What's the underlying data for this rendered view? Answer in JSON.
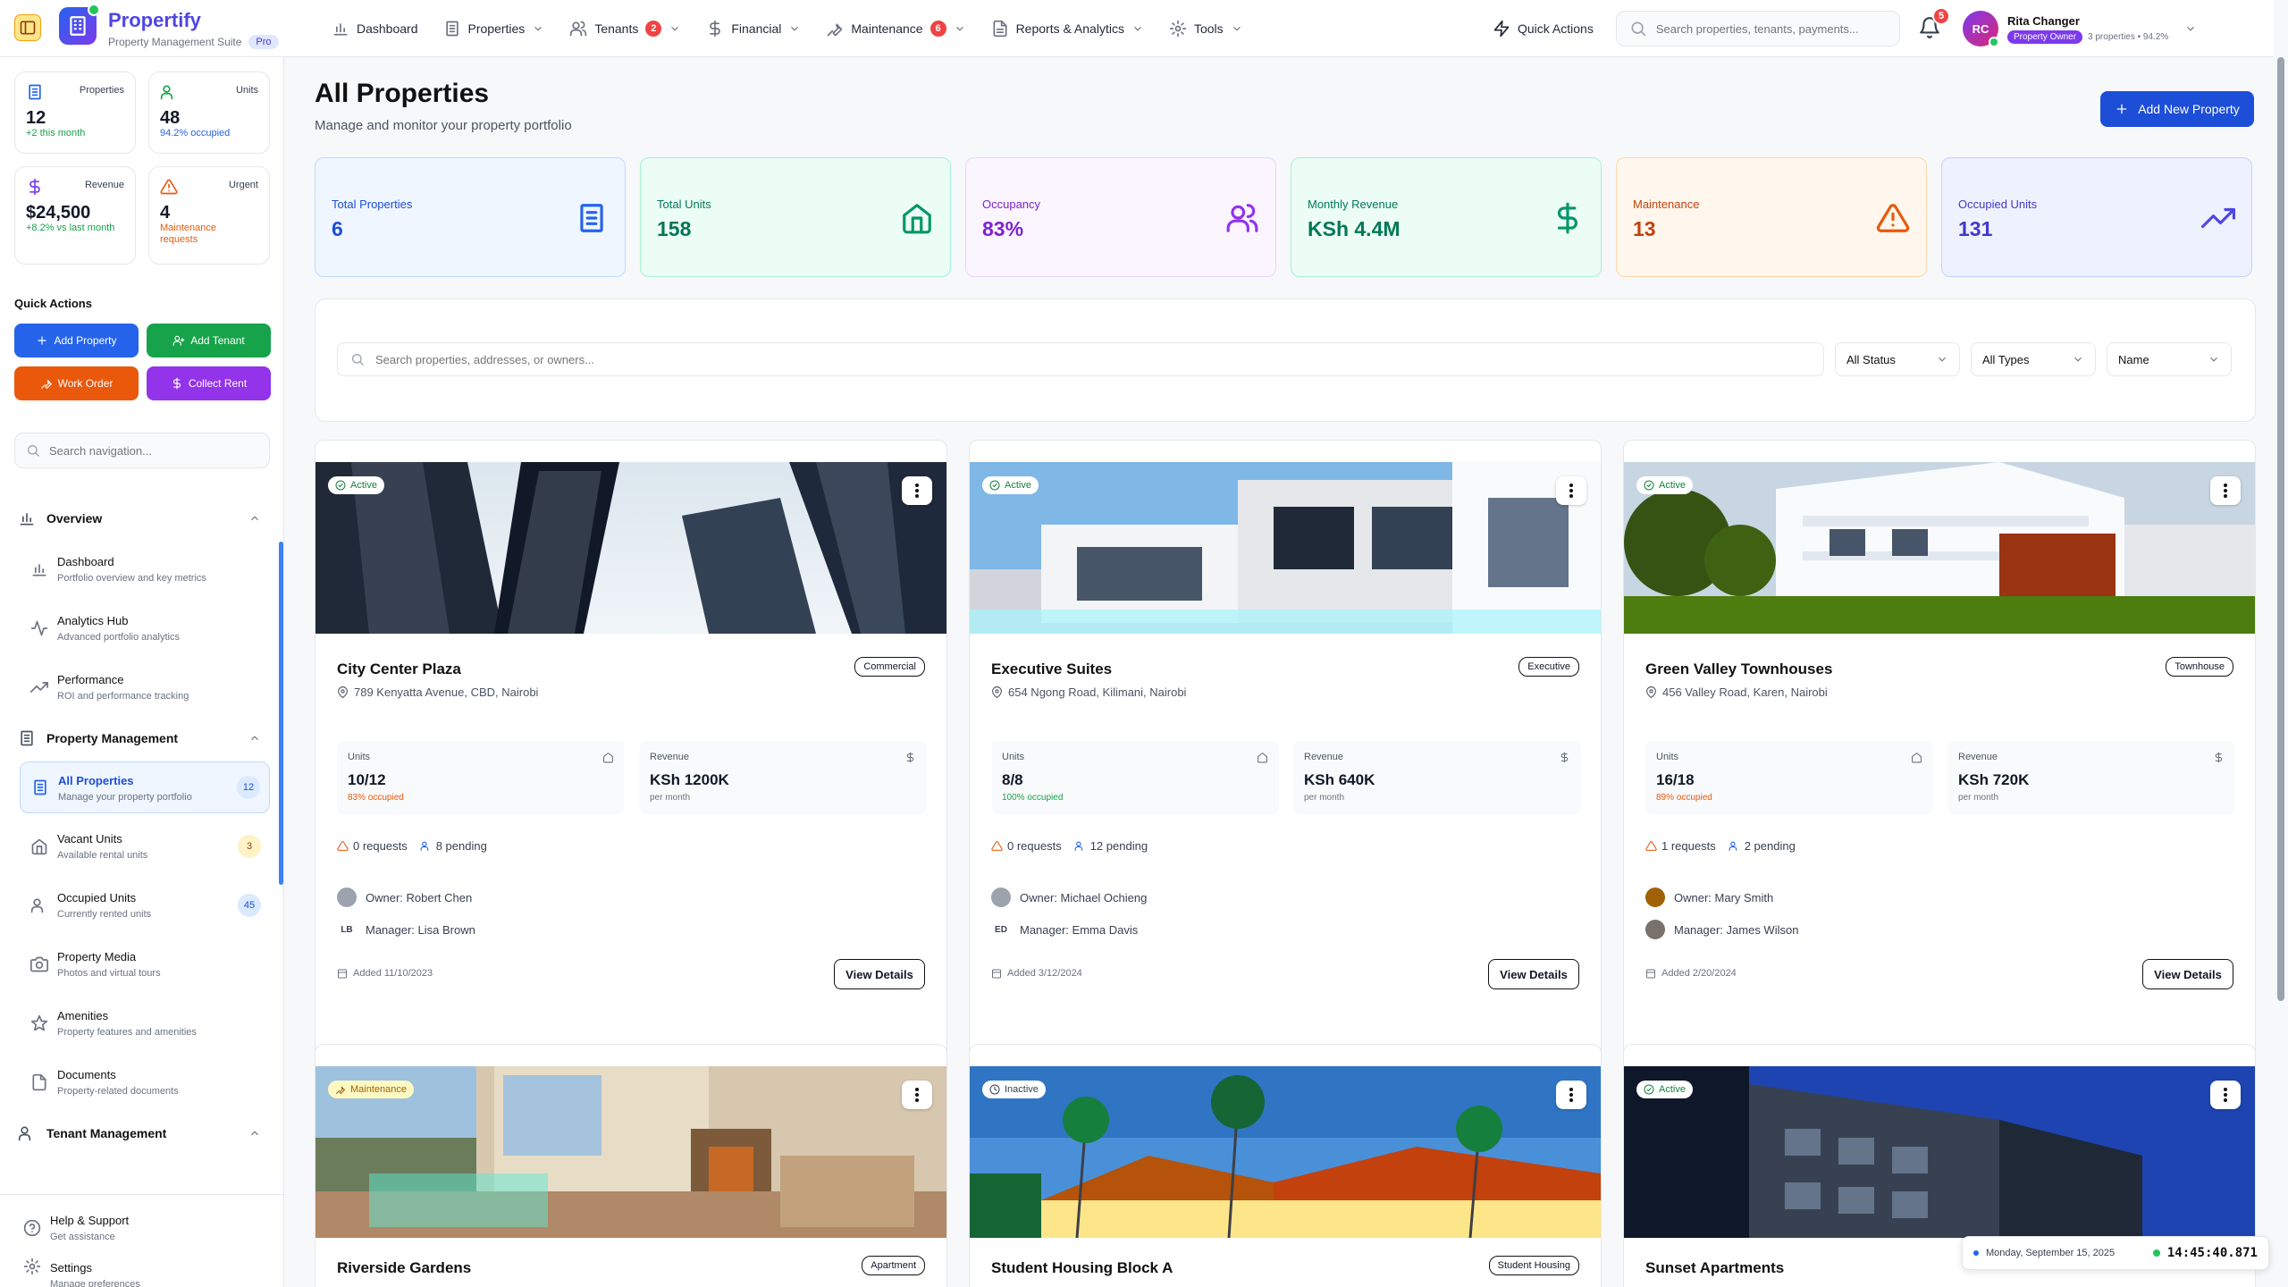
{
  "app": {
    "name": "Propertify",
    "subtitle": "Property Management Suite",
    "edition": "Pro"
  },
  "nav": [
    {
      "label": "Dashboard",
      "icon": "bar-chart-icon"
    },
    {
      "label": "Properties",
      "icon": "building-icon"
    },
    {
      "label": "Tenants",
      "icon": "users-icon",
      "badge": "2"
    },
    {
      "label": "Financial",
      "icon": "dollar-icon"
    },
    {
      "label": "Maintenance",
      "icon": "wrench-icon",
      "badge": "6"
    },
    {
      "label": "Reports & Analytics",
      "icon": "file-icon"
    },
    {
      "label": "Tools",
      "icon": "gear-icon"
    }
  ],
  "header": {
    "quick_actions": "Quick Actions",
    "search_placeholder": "Search properties, tenants, payments...",
    "notifications": "5",
    "user": {
      "initials": "RC",
      "name": "Rita Changer",
      "role": "Property Owner",
      "stats": "3 properties • 94.2%"
    }
  },
  "sidebar": {
    "stats": [
      {
        "label": "Properties",
        "value": "12",
        "sub": "+2 this month"
      },
      {
        "label": "Units",
        "value": "48",
        "sub": "94.2% occupied"
      },
      {
        "label": "Revenue",
        "value": "$24,500",
        "sub": "+8.2% vs last month"
      },
      {
        "label": "Urgent",
        "value": "4",
        "sub": "Maintenance requests"
      }
    ],
    "quick_actions_title": "Quick Actions",
    "quick_actions": [
      "Add Property",
      "Add Tenant",
      "Work Order",
      "Collect Rent"
    ],
    "search_placeholder": "Search navigation...",
    "sections": [
      {
        "title": "Overview",
        "items": [
          {
            "title": "Dashboard",
            "desc": "Portfolio overview and key metrics"
          },
          {
            "title": "Analytics Hub",
            "desc": "Advanced portfolio analytics"
          },
          {
            "title": "Performance",
            "desc": "ROI and performance tracking"
          }
        ]
      },
      {
        "title": "Property Management",
        "items": [
          {
            "title": "All Properties",
            "desc": "Manage your property portfolio",
            "count": "12"
          },
          {
            "title": "Vacant Units",
            "desc": "Available rental units",
            "count": "3"
          },
          {
            "title": "Occupied Units",
            "desc": "Currently rented units",
            "count": "45"
          },
          {
            "title": "Property Media",
            "desc": "Photos and virtual tours"
          },
          {
            "title": "Amenities",
            "desc": "Property features and amenities"
          },
          {
            "title": "Documents",
            "desc": "Property-related documents"
          }
        ]
      },
      {
        "title": "Tenant Management",
        "items": []
      }
    ],
    "footer": [
      {
        "title": "Help & Support",
        "desc": "Get assistance"
      },
      {
        "title": "Settings",
        "desc": "Manage preferences"
      }
    ]
  },
  "page": {
    "title": "All Properties",
    "subtitle": "Manage and monitor your property portfolio",
    "add_button": "Add New Property",
    "kpis": [
      {
        "label": "Total Properties",
        "value": "6",
        "icon": "building-icon"
      },
      {
        "label": "Total Units",
        "value": "158",
        "icon": "home-icon"
      },
      {
        "label": "Occupancy",
        "value": "83%",
        "icon": "users-icon"
      },
      {
        "label": "Monthly Revenue",
        "value": "KSh 4.4M",
        "icon": "dollar-icon"
      },
      {
        "label": "Maintenance",
        "value": "13",
        "icon": "warning-icon"
      },
      {
        "label": "Occupied Units",
        "value": "131",
        "icon": "trending-up-icon"
      }
    ],
    "search_placeholder": "Search properties, addresses, or owners...",
    "filters": [
      "All Status",
      "All Types",
      "Name"
    ]
  },
  "properties": [
    {
      "name": "City Center Plaza",
      "type": "Commercial",
      "status": "Active",
      "address": "789 Kenyatta Avenue, CBD, Nairobi",
      "units": "10/12",
      "occupied": "83% occupied",
      "revenue": "KSh 1200K",
      "revenue_sub": "per month",
      "units_label": "Units",
      "revenue_label": "Revenue",
      "requests": "0 requests",
      "pending": "8 pending",
      "owner": "Owner: Robert Chen",
      "manager": "Manager: Lisa Brown",
      "manager_initials": "LB",
      "added": "Added 11/10/2023",
      "view": "View Details"
    },
    {
      "name": "Executive Suites",
      "type": "Executive",
      "status": "Active",
      "address": "654 Ngong Road, Kilimani, Nairobi",
      "units": "8/8",
      "occupied": "100% occupied",
      "revenue": "KSh 640K",
      "revenue_sub": "per month",
      "units_label": "Units",
      "revenue_label": "Revenue",
      "requests": "0 requests",
      "pending": "12 pending",
      "owner": "Owner: Michael Ochieng",
      "manager": "Manager: Emma Davis",
      "manager_initials": "ED",
      "added": "Added 3/12/2024",
      "view": "View Details"
    },
    {
      "name": "Green Valley Townhouses",
      "type": "Townhouse",
      "status": "Active",
      "address": "456 Valley Road, Karen, Nairobi",
      "units": "16/18",
      "occupied": "89% occupied",
      "revenue": "KSh 720K",
      "revenue_sub": "per month",
      "units_label": "Units",
      "revenue_label": "Revenue",
      "requests": "1 requests",
      "pending": "2 pending",
      "owner": "Owner: Mary Smith",
      "manager": "Manager: James Wilson",
      "manager_initials": "",
      "added": "Added 2/20/2024",
      "view": "View Details"
    },
    {
      "name": "Riverside Gardens",
      "type": "Apartment",
      "status": "Maintenance"
    },
    {
      "name": "Student Housing Block A",
      "type": "Student Housing",
      "status": "Inactive"
    },
    {
      "name": "Sunset Apartments",
      "type": "",
      "status": "Active"
    }
  ],
  "clock": {
    "date": "Monday, September 15, 2025",
    "time": "14:45:40.871"
  }
}
